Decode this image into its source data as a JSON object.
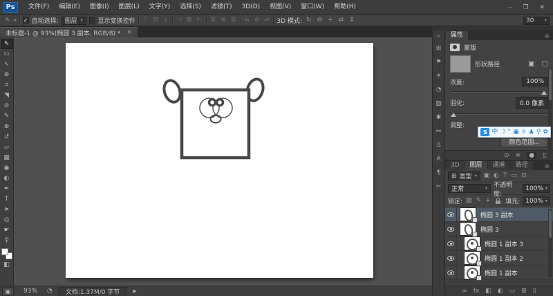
{
  "ui": {
    "arrow_down": "▾",
    "check": "✓"
  },
  "window_controls": {
    "minimize": "–",
    "restore": "❐",
    "close": "✕"
  },
  "menubar": {
    "logo": "Ps",
    "items": [
      "文件(F)",
      "编辑(E)",
      "图像(I)",
      "图层(L)",
      "文字(Y)",
      "选择(S)",
      "滤镜(T)",
      "3D(D)",
      "视图(V)",
      "窗口(W)",
      "帮助(H)"
    ]
  },
  "options_bar": {
    "tool_preset_icon": "⇖",
    "auto_select_label": "自动选择:",
    "auto_select_value": "图层",
    "show_transform_label": "显示变换控件",
    "align_icons": [
      "⊤",
      "⊟",
      "⊥",
      "⊣",
      "⊞",
      "⊢",
      "≣",
      "≡",
      "≣",
      "⇋",
      "⊜",
      "⇌"
    ],
    "mode_3d_label": "3D 模式:",
    "mode_3d_icons": [
      "↻",
      "⊖",
      "∔",
      "⇄",
      "⇕"
    ],
    "value_box": "30"
  },
  "document_tab": {
    "title": "未标题-1 @ 93%(椭圆 3 副本, RGB/8) *",
    "close_icon": "×"
  },
  "toolbar": {
    "tools": [
      {
        "name": "move-tool",
        "glyph": "⇖"
      },
      {
        "name": "rectangular-marquee-tool",
        "glyph": "▭"
      },
      {
        "name": "lasso-tool",
        "glyph": "∿"
      },
      {
        "name": "quick-selection-tool",
        "glyph": "⊛"
      },
      {
        "name": "crop-tool",
        "glyph": "⌗"
      },
      {
        "name": "eyedropper-tool",
        "glyph": "◥"
      },
      {
        "name": "spot-healing-brush-tool",
        "glyph": "⊘"
      },
      {
        "name": "brush-tool",
        "glyph": "✎"
      },
      {
        "name": "clone-stamp-tool",
        "glyph": "⊕"
      },
      {
        "name": "history-brush-tool",
        "glyph": "↺"
      },
      {
        "name": "eraser-tool",
        "glyph": "▱"
      },
      {
        "name": "gradient-tool",
        "glyph": "▦"
      },
      {
        "name": "blur-tool",
        "glyph": "◉"
      },
      {
        "name": "dodge-tool",
        "glyph": "◐"
      },
      {
        "name": "pen-tool",
        "glyph": "✒"
      },
      {
        "name": "type-tool",
        "glyph": "T"
      },
      {
        "name": "path-selection-tool",
        "glyph": "➤"
      },
      {
        "name": "ellipse-tool",
        "glyph": "◎"
      },
      {
        "name": "hand-tool",
        "glyph": "☛"
      },
      {
        "name": "zoom-tool",
        "glyph": "⚲"
      }
    ],
    "quick_mask_icon": "◧",
    "foreground_color": "#ffffff",
    "background_color": "#ffffff"
  },
  "dock": {
    "collapse_icon": "«",
    "icons": [
      "⊞",
      "⚑",
      "☀",
      "◔",
      "▧",
      "✱",
      "≔",
      "♙",
      "A",
      "¶",
      "✂"
    ]
  },
  "properties_panel": {
    "tab": "属性",
    "panel_menu_icon": "≡",
    "mask_label": "蒙版",
    "path_label": "形状路径",
    "mask_buttons": [
      "▣",
      "▢"
    ],
    "density_label": "浓度:",
    "density_value": "100%",
    "feather_label": "羽化:",
    "feather_value": "0.0 像素",
    "refine_label": "调整:",
    "color_range_button": "颜色范围...",
    "bottom_icons": [
      "⊙",
      "≋",
      "●",
      "▯"
    ]
  },
  "ime_bar": {
    "items": [
      {
        "name": "ime-logo-icon",
        "glyph": "S"
      },
      {
        "name": "chinese-mode-icon",
        "glyph": "中"
      },
      {
        "name": "halfwidth-icon",
        "glyph": "☽"
      },
      {
        "name": "punctuation-icon",
        "glyph": "”"
      },
      {
        "name": "emoji-icon",
        "glyph": "▣"
      },
      {
        "name": "skin-icon",
        "glyph": "♕"
      },
      {
        "name": "account-icon",
        "glyph": "♟"
      },
      {
        "name": "search-icon",
        "glyph": "⚲"
      },
      {
        "name": "settings-icon",
        "glyph": "✿"
      }
    ]
  },
  "layers_panel": {
    "tabs": [
      "3D",
      "图层",
      "通道",
      "路径"
    ],
    "active_tab": "图层",
    "panel_menu_icon": "≡",
    "filter_icon": "⊞",
    "filter_label": "类型",
    "filter_type_icons": [
      "▣",
      "◐",
      "T",
      "▭",
      "⊡"
    ],
    "blend_mode": "正常",
    "opacity_label": "不透明度:",
    "opacity_value": "100%",
    "lock_label": "锁定:",
    "lock_icons": [
      "▨",
      "✎",
      "∔"
    ],
    "fill_label": "填充:",
    "fill_value": "100%",
    "layers": [
      {
        "name": "椭圆 3 副本",
        "selected": true
      },
      {
        "name": "椭圆 3",
        "selected": false
      },
      {
        "name": "椭圆 1 副本 3",
        "selected": false
      },
      {
        "name": "椭圆 1 副本 2",
        "selected": false
      },
      {
        "name": "椭圆 1 副本",
        "selected": false
      }
    ],
    "bottom_icons": [
      {
        "name": "link-layers-icon",
        "glyph": "∞"
      },
      {
        "name": "layer-effects-icon",
        "glyph": "fx"
      },
      {
        "name": "add-layer-mask-icon",
        "glyph": "◧"
      },
      {
        "name": "adjustment-layer-icon",
        "glyph": "◐"
      },
      {
        "name": "layer-group-icon",
        "glyph": "▭"
      },
      {
        "name": "new-layer-icon",
        "glyph": "⊞"
      },
      {
        "name": "delete-layer-icon",
        "glyph": "▯"
      }
    ]
  },
  "status_bar": {
    "screen_mode_icon": "▣",
    "zoom_value": "93%",
    "sync_icon": "◔",
    "doc_label": "文档:1.37M/0 字节",
    "expand_icon": "▶"
  },
  "colors": {
    "selection_blue": "#4e5b66",
    "ime_blue": "#2a8ce0",
    "ps_logo_blue": "#15518c"
  }
}
